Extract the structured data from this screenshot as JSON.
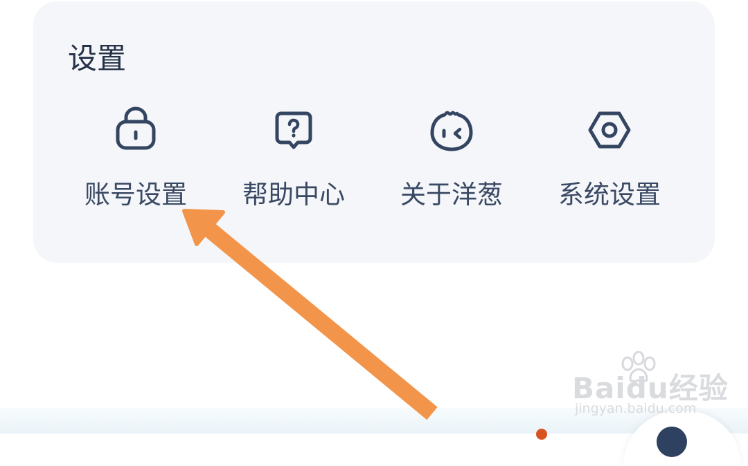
{
  "settings": {
    "title": "设置",
    "items": [
      {
        "label": "账号设置",
        "icon": "lock-icon"
      },
      {
        "label": "帮助中心",
        "icon": "help-bubble-icon"
      },
      {
        "label": "关于洋葱",
        "icon": "onion-mascot-icon"
      },
      {
        "label": "系统设置",
        "icon": "hexagon-gear-icon"
      }
    ]
  },
  "annotation": {
    "arrow_color": "#f2944a",
    "target": "账号设置"
  },
  "watermark": {
    "logo": "Baidu经验",
    "url": "jingyan.baidu.com"
  },
  "colors": {
    "card_bg": "#f4f6f9",
    "icon_stroke": "#344562",
    "title_text": "#243147",
    "label_text": "#3a4963"
  }
}
